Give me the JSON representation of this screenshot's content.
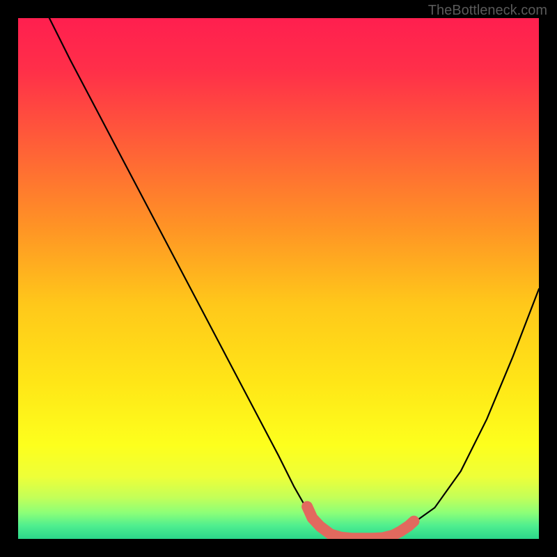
{
  "watermark": "TheBottleneck.com",
  "chart_data": {
    "type": "line",
    "title": "",
    "xlabel": "",
    "ylabel": "",
    "xlim": [
      0,
      100
    ],
    "ylim": [
      0,
      100
    ],
    "series": [
      {
        "name": "bottleneck-curve",
        "x": [
          6,
          10,
          15,
          20,
          25,
          30,
          35,
          40,
          45,
          50,
          53,
          55,
          58,
          61,
          65,
          70,
          73,
          80,
          85,
          90,
          95,
          100
        ],
        "values": [
          100,
          92,
          82.5,
          73,
          63.5,
          54,
          44.5,
          35,
          25.5,
          16,
          10,
          6.5,
          2.5,
          0.5,
          0,
          0,
          1,
          6,
          13,
          23,
          35,
          48
        ]
      }
    ],
    "highlight_band": {
      "name": "optimal-range",
      "points": [
        {
          "x": 55.5,
          "y": 6.2
        },
        {
          "x": 56.5,
          "y": 4.0
        },
        {
          "x": 58.0,
          "y": 2.4
        },
        {
          "x": 60.0,
          "y": 0.9
        },
        {
          "x": 62.0,
          "y": 0.3
        },
        {
          "x": 64.0,
          "y": 0.1
        },
        {
          "x": 66.0,
          "y": 0.1
        },
        {
          "x": 68.0,
          "y": 0.1
        },
        {
          "x": 70.0,
          "y": 0.2
        },
        {
          "x": 72.0,
          "y": 0.7
        },
        {
          "x": 73.5,
          "y": 1.5
        },
        {
          "x": 75.0,
          "y": 2.5
        },
        {
          "x": 76.0,
          "y": 3.4
        }
      ]
    },
    "gradient_stops": [
      {
        "offset": 0.0,
        "color": "#ff1f4f"
      },
      {
        "offset": 0.1,
        "color": "#ff2f49"
      },
      {
        "offset": 0.25,
        "color": "#ff6137"
      },
      {
        "offset": 0.4,
        "color": "#ff9325"
      },
      {
        "offset": 0.55,
        "color": "#ffc81a"
      },
      {
        "offset": 0.7,
        "color": "#ffe617"
      },
      {
        "offset": 0.82,
        "color": "#fdff1d"
      },
      {
        "offset": 0.88,
        "color": "#eeff38"
      },
      {
        "offset": 0.92,
        "color": "#c4ff58"
      },
      {
        "offset": 0.95,
        "color": "#8cff78"
      },
      {
        "offset": 0.975,
        "color": "#4eee8f"
      },
      {
        "offset": 1.0,
        "color": "#2bd68a"
      }
    ],
    "highlight_color": "#e2695e"
  }
}
